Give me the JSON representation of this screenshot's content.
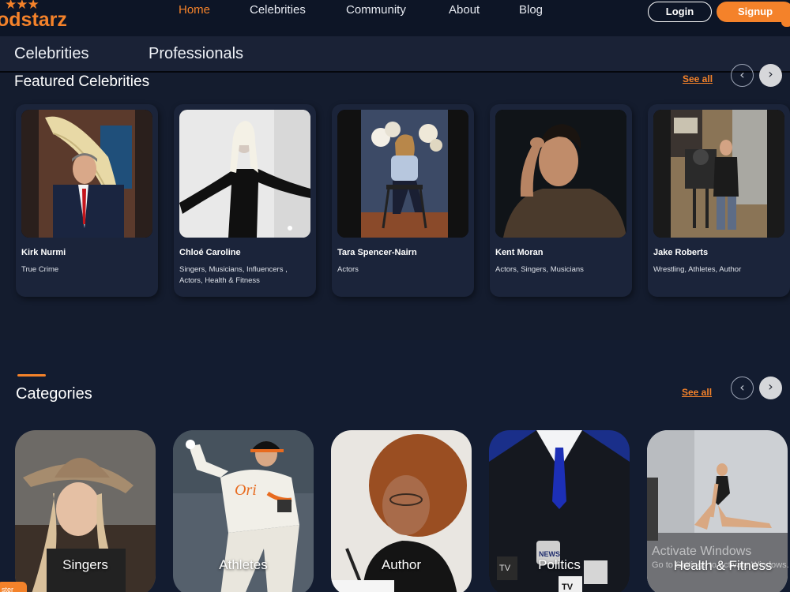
{
  "brand": {
    "name": "Podstarz",
    "visible_wordmark": "odstarz",
    "stars_glyph": "★★★",
    "accent": "#f4822a"
  },
  "topnav": {
    "links": [
      {
        "label": "Home",
        "active": true
      },
      {
        "label": "Celebrities",
        "active": false
      },
      {
        "label": "Community",
        "active": false
      },
      {
        "label": "About",
        "active": false
      },
      {
        "label": "Blog",
        "active": false
      }
    ],
    "login_label": "Login",
    "signup_label": "Signup"
  },
  "subtabs": {
    "celebrities": "Celebrities",
    "professionals": "Professionals"
  },
  "featured": {
    "title": "Featured Celebrities",
    "see_all": "See all",
    "prev_icon": "‹",
    "next_icon": "›",
    "cards": [
      {
        "name": "Kirk Nurmi",
        "categories": "True Crime"
      },
      {
        "name": "Chloé Caroline",
        "categories": "Singers, Musicians, Influencers , Actors, Health & Fitness"
      },
      {
        "name": "Tara Spencer-Nairn",
        "categories": "Actors"
      },
      {
        "name": "Kent Moran",
        "categories": "Actors, Singers, Musicians"
      },
      {
        "name": "Jake Roberts",
        "categories": "Wrestling, Athletes, Author"
      }
    ]
  },
  "categories": {
    "title": "Categories",
    "see_all": "See all",
    "prev_icon": "‹",
    "next_icon": "›",
    "items": [
      {
        "label": "Singers"
      },
      {
        "label": "Athletes"
      },
      {
        "label": "Author"
      },
      {
        "label": "Politics"
      },
      {
        "label": "Health & Fitness"
      }
    ]
  },
  "watermark": {
    "title": "Activate Windows",
    "subtitle": "Go to Settings to activate Windows."
  },
  "chat_tab": "ster"
}
